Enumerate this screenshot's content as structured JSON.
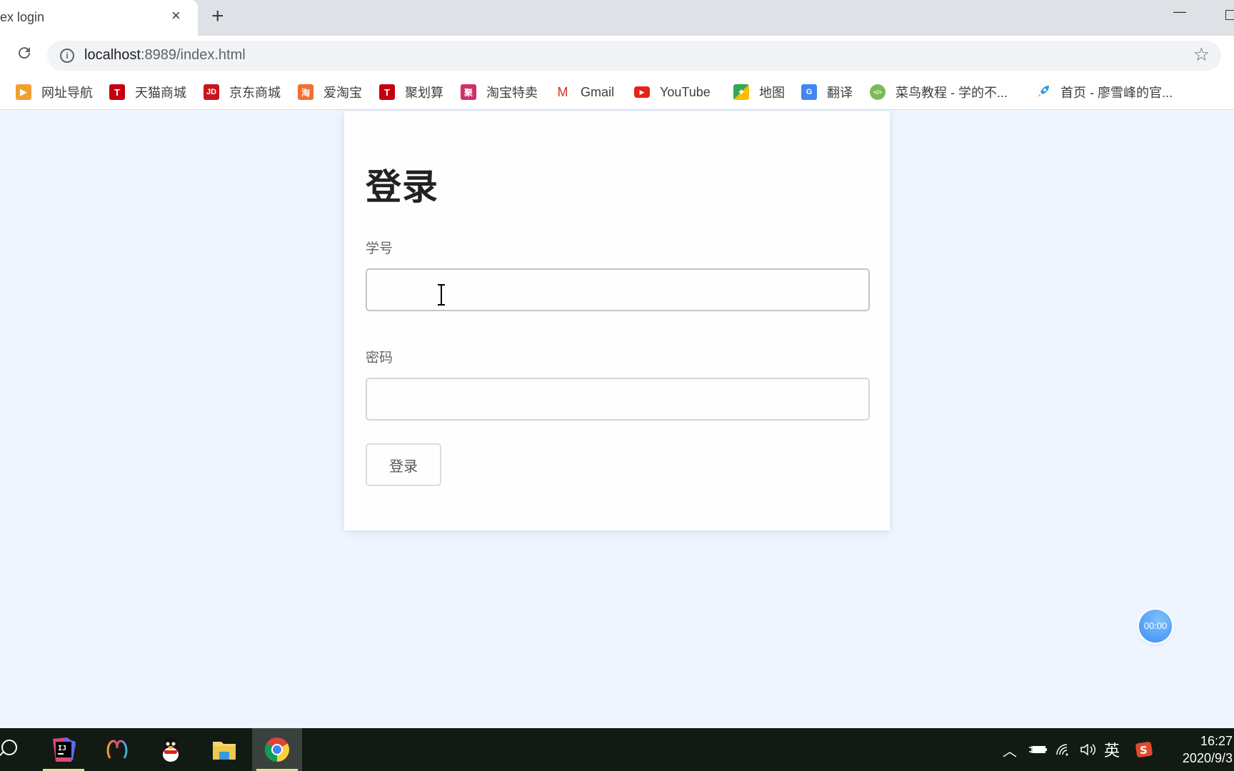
{
  "browser": {
    "tab": {
      "title": "ex login",
      "close_icon": "×"
    },
    "new_tab_icon": "+",
    "window": {
      "minimize_icon": "—"
    },
    "address_bar": {
      "host": "localhost",
      "path": ":8989/index.html"
    },
    "bookmarks": [
      {
        "label": "网址导航",
        "icon": "arrow-icon",
        "color": "#f0a030",
        "glyph": "▶"
      },
      {
        "label": "天猫商城",
        "icon": "tmall-icon",
        "color": "#c40010",
        "glyph": "T"
      },
      {
        "label": "京东商城",
        "icon": "jd-icon",
        "color": "#c9151e",
        "glyph": "JD"
      },
      {
        "label": "爱淘宝",
        "icon": "taobao-icon",
        "color": "#f07030",
        "glyph": "淘"
      },
      {
        "label": "聚划算",
        "icon": "juhuasuan-icon",
        "color": "#c40010",
        "glyph": "T"
      },
      {
        "label": "淘宝特卖",
        "icon": "taobao-sale-icon",
        "color": "#d0306a",
        "glyph": "聚"
      },
      {
        "label": "Gmail",
        "icon": "gmail-icon",
        "color": "#ffffff",
        "glyph": "M"
      },
      {
        "label": "YouTube",
        "icon": "youtube-icon",
        "color": "#e62117",
        "glyph": "▶"
      },
      {
        "label": "地图",
        "icon": "maps-icon",
        "color": "#34a853",
        "glyph": "⌖"
      },
      {
        "label": "翻译",
        "icon": "translate-icon",
        "color": "#4285f4",
        "glyph": "G"
      },
      {
        "label": "菜鸟教程 - 学的不...",
        "icon": "runoob-icon",
        "color": "#7cba59",
        "glyph": "</>"
      },
      {
        "label": "首页 - 廖雪峰的官...",
        "icon": "rocket-icon",
        "color": "#ffffff",
        "glyph": "🚀"
      }
    ]
  },
  "login": {
    "title": "登录",
    "student_id_label": "学号",
    "student_id_value": "",
    "password_label": "密码",
    "password_value": "",
    "submit_label": "登录"
  },
  "timer": {
    "value": "00:00"
  },
  "taskbar": {
    "apps": [
      {
        "name": "intellij-idea",
        "active": false
      },
      {
        "name": "navicat",
        "active": false
      },
      {
        "name": "qq",
        "active": false
      },
      {
        "name": "file-explorer",
        "active": false
      },
      {
        "name": "chrome",
        "active": true
      }
    ],
    "tray": {
      "ime": "英"
    },
    "clock": {
      "time": "16:27",
      "date": "2020/9/3"
    }
  }
}
